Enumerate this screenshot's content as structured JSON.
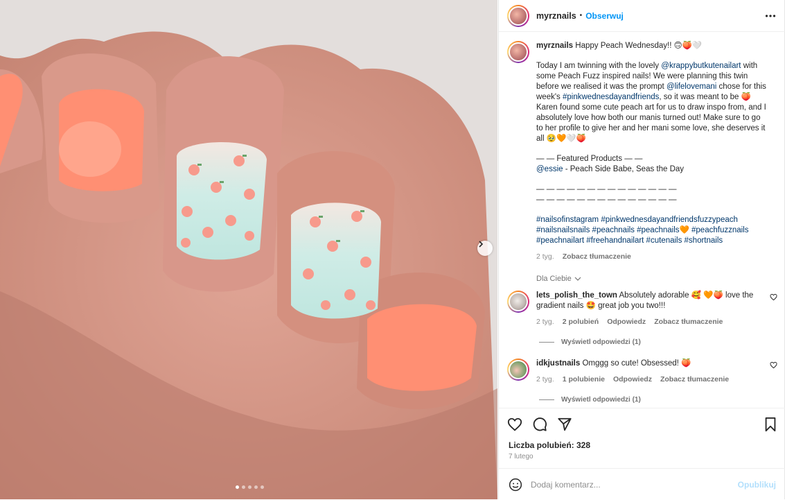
{
  "post": {
    "username": "myrznails",
    "separator": "•",
    "follow_label": "Obserwuj",
    "caption": {
      "username": "myrznails",
      "headline": "Happy Peach Wednesday!! 🙃🍑🤍",
      "intro_1": "Today I am twinning with the lovely ",
      "mention_1": "@krappybutkutenailart",
      "intro_2": " with some Peach Fuzz inspired nails! We were planning this twin before we realised it was the prompt ",
      "mention_2": "@lifelovemani",
      "intro_3": " chose for this week's ",
      "hashtag_1": "#pinkwednesdayandfriends",
      "intro_4": ", so it was meant to be 🍑 Karen found some cute peach art for us to draw inspo from, and I absolutely love how both our manis turned out! Make sure to go to her profile to give her and her mani some love, she deserves it all 🥹🧡🤍🍑",
      "featured": "— — Featured Products — —",
      "mention_essie": "@essie",
      "products": " - Peach Side Babe, Seas the Day",
      "dashes": "— — — — — — — — — — — — — —\n— — — — — — — — — — — — — —",
      "hashtags": "#nailsofinstagram #pinkwednesdayandfriendsfuzzypeach #nailsnailsnails #peachnails #peachnails🧡 #peachfuzznails #peachnailart #freehandnailart #cutenails #shortnails",
      "time": "2 tyg.",
      "translate": "Zobacz tłumaczenie"
    },
    "for_you": "Dla Ciebie",
    "comments": [
      {
        "username": "lets_polish_the_town",
        "text": "Absolutely adorable 🥰 🧡🍑 love the gradient nails 🤩 great job you two!!!",
        "time": "2 tyg.",
        "likes": "2 polubień",
        "reply": "Odpowiedz",
        "translate": "Zobacz tłumaczenie",
        "view_replies": "Wyświetl odpowiedzi (1)"
      },
      {
        "username": "idkjustnails",
        "text": "Omggg so cute! Obsessed! 🍑",
        "time": "2 tyg.",
        "likes": "1 polubienie",
        "reply": "Odpowiedz",
        "translate": "Zobacz tłumaczenie",
        "view_replies": "Wyświetl odpowiedzi (1)"
      }
    ],
    "likes_label": "Liczba polubień: 328",
    "date": "7 lutego",
    "comment_placeholder": "Dodaj komentarz...",
    "publish_label": "Opublikuj",
    "carousel": {
      "total": 5,
      "active": 1
    }
  },
  "icons": {
    "more": "more-dots-icon",
    "next": "chevron-right-icon",
    "like": "heart-icon",
    "comment": "comment-icon",
    "share": "send-icon",
    "save": "bookmark-icon",
    "emoji": "emoji-icon"
  },
  "colors": {
    "link": "#00376b",
    "follow": "#0095f6",
    "publish_disabled": "#b2dffc"
  }
}
